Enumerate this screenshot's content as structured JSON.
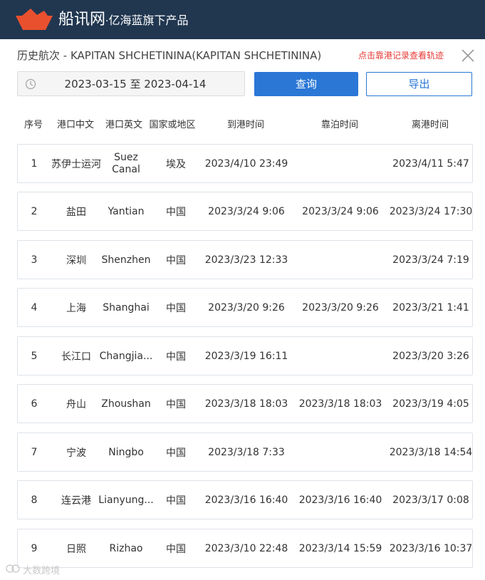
{
  "header": {
    "brand": "船讯网",
    "slogan": "亿海蓝旗下产品"
  },
  "title": "历史航次 - KAPITAN SHCHETININA(KAPITAN SHCHETININA)",
  "hint": "点击靠港记录查看轨迹",
  "date_range": "2023-03-15 至 2023-04-14",
  "buttons": {
    "query": "查询",
    "export": "导出"
  },
  "columns": [
    "序号",
    "港口中文",
    "港口英文",
    "国家或地区",
    "到港时间",
    "靠泊时间",
    "离港时间"
  ],
  "rows": [
    {
      "idx": "1",
      "cn": "苏伊士运河",
      "en": "Suez Canal",
      "country": "埃及",
      "arrive": "2023/4/10 23:49",
      "berth": "",
      "depart": "2023/4/11 5:47"
    },
    {
      "idx": "2",
      "cn": "盐田",
      "en": "Yantian",
      "country": "中国",
      "arrive": "2023/3/24 9:06",
      "berth": "2023/3/24 9:06",
      "depart": "2023/3/24 17:30"
    },
    {
      "idx": "3",
      "cn": "深圳",
      "en": "Shenzhen",
      "country": "中国",
      "arrive": "2023/3/23 12:33",
      "berth": "",
      "depart": "2023/3/24 7:19"
    },
    {
      "idx": "4",
      "cn": "上海",
      "en": "Shanghai",
      "country": "中国",
      "arrive": "2023/3/20 9:26",
      "berth": "2023/3/20 9:26",
      "depart": "2023/3/21 1:41"
    },
    {
      "idx": "5",
      "cn": "长江口",
      "en": "Changjia...",
      "country": "中国",
      "arrive": "2023/3/19 16:11",
      "berth": "",
      "depart": "2023/3/20 3:26"
    },
    {
      "idx": "6",
      "cn": "舟山",
      "en": "Zhoushan",
      "country": "中国",
      "arrive": "2023/3/18 18:03",
      "berth": "2023/3/18 18:03",
      "depart": "2023/3/19 4:05"
    },
    {
      "idx": "7",
      "cn": "宁波",
      "en": "Ningbo",
      "country": "中国",
      "arrive": "2023/3/18 7:33",
      "berth": "",
      "depart": "2023/3/18 14:54"
    },
    {
      "idx": "8",
      "cn": "连云港",
      "en": "Lianyung...",
      "country": "中国",
      "arrive": "2023/3/16 16:40",
      "berth": "2023/3/16 16:40",
      "depart": "2023/3/17 0:08"
    },
    {
      "idx": "9",
      "cn": "日照",
      "en": "Rizhao",
      "country": "中国",
      "arrive": "2023/3/10 22:48",
      "berth": "2023/3/14 15:59",
      "depart": "2023/3/16 10:37"
    }
  ],
  "watermark": "大数跨境",
  "colors": {
    "topbar": "#213750",
    "primary": "#2a77d6",
    "hint": "#e53935",
    "logo": "#e8502e"
  }
}
